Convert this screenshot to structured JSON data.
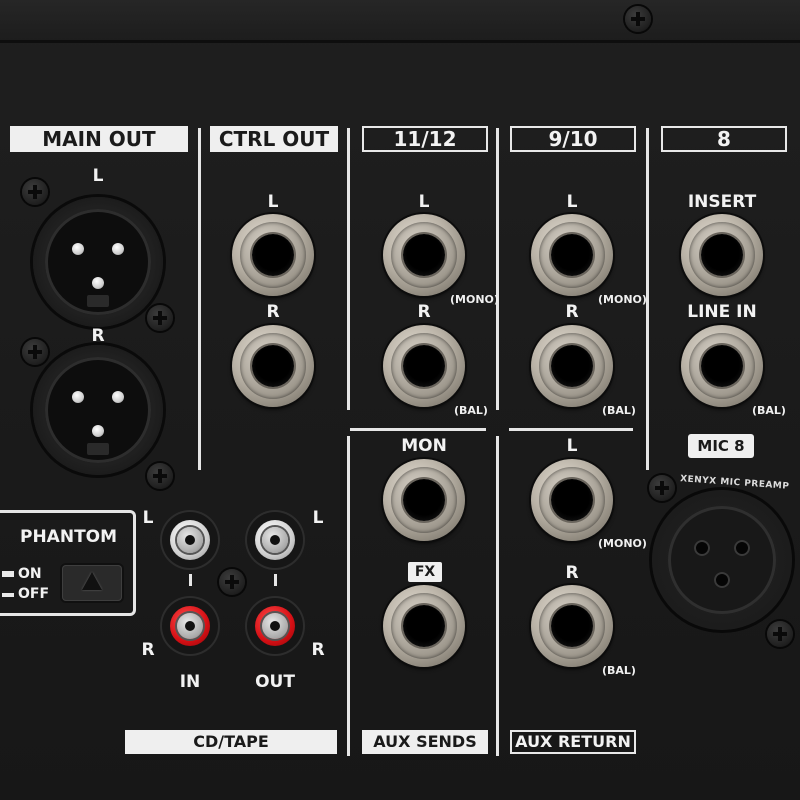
{
  "sections": {
    "main_out": "MAIN OUT",
    "ctrl_out": "CTRL OUT",
    "ch_11_12": "11/12",
    "ch_9_10": "9/10",
    "ch_8": "8"
  },
  "footers": {
    "cd_tape": "CD/TAPE",
    "aux_sends": "AUX SENDS",
    "aux_return": "AUX RETURN"
  },
  "labels": {
    "L": "L",
    "R": "R",
    "mono": "(MONO)",
    "bal": "(BAL)",
    "insert": "INSERT",
    "line_in": "LINE IN",
    "mic8": "MIC 8",
    "mic_preamp": "XENYX MIC PREAMP",
    "mon": "MON",
    "fx": "FX",
    "in": "IN",
    "out": "OUT"
  },
  "phantom": {
    "title": "PHANTOM",
    "on": "ON",
    "off": "OFF"
  },
  "colors": {
    "panel": "#1c1c1c",
    "label_fill": "#efefef",
    "rca_red": "#d40f14",
    "rca_white": "#e8e8e8"
  }
}
